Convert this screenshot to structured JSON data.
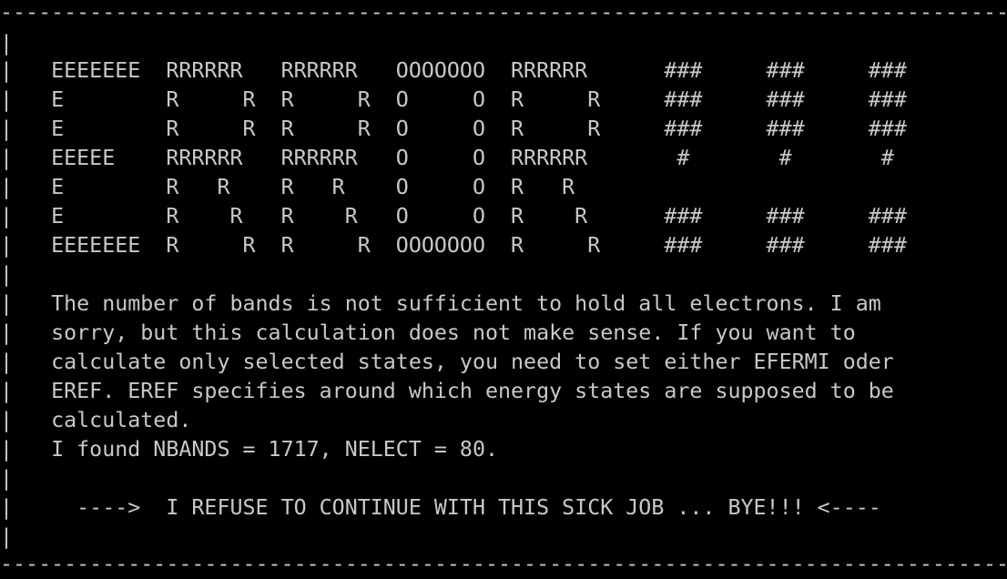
{
  "terminal": {
    "border_top": "--------------------------------------------------------------------------------",
    "border_bottom": "--------------------------------------------------------------------------------",
    "banner": [
      "    EEEEEEE  RRRRRR   RRRRRR   OOOOOOO  RRRRRR      ###     ###     ###",
      "    E        R     R  R     R  O     O  R     R     ###     ###     ###",
      "    E        R     R  R     R  O     O  R     R     ###     ###     ###",
      "    EEEEE    RRRRRR   RRRRRR   O     O  RRRRRR       #       #       #",
      "    E        R   R    R   R    O     O  R   R",
      "    E        R    R   R    R   O     O  R    R      ###     ###     ###",
      "    EEEEEEE  R     R  R     R  OOOOOOO  R     R     ###     ###     ###"
    ],
    "message": [
      "    The number of bands is not sufficient to hold all electrons. I am",
      "    sorry, but this calculation does not make sense. If you want to",
      "    calculate only selected states, you need to set either EFERMI oder",
      "    EREF. EREF specifies around which energy states are supposed to be",
      "    calculated.",
      "    I found NBANDS = 1717, NELECT = 80."
    ],
    "final": "      ---->  I REFUSE TO CONTINUE WITH THIS SICK JOB ... BYE!!! <----"
  }
}
